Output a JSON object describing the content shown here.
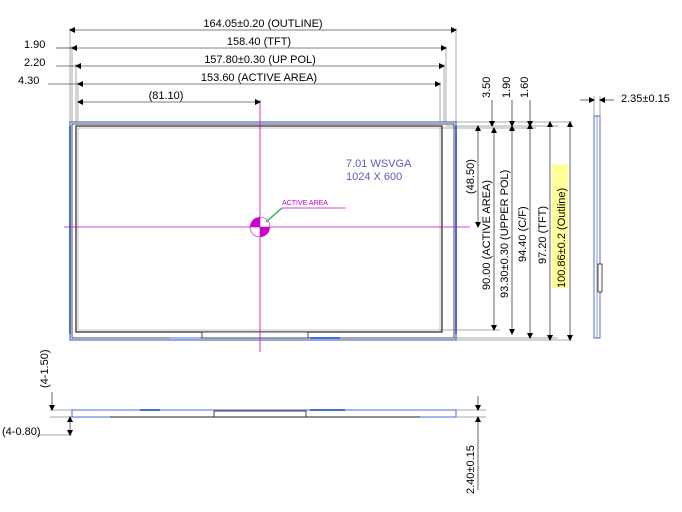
{
  "dimensions": {
    "outline_width": "164.05±0.20 (OUTLINE)",
    "tft_width": "158.40 (TFT)",
    "up_pol_width": "157.80±0.30 (UP POL)",
    "active_area_width": "153.60 (ACTIVE AREA)",
    "center_x": "(81.10)",
    "offset_1": "1.90",
    "offset_2": "2.20",
    "offset_3": "4.30",
    "top_3_50": "3.50",
    "top_1_90": "1.90",
    "top_1_60": "1.60",
    "side_thickness": "2.35±0.15",
    "center_y": "(48.50)",
    "active_area_height": "90.00 (ACTIVE AREA)",
    "upper_pol_height": "93.30±0.30 (UPPER POL)",
    "cf_height": "94.40 (C/F)",
    "tft_height": "97.20 (TFT)",
    "outline_height": "100.86±0.2 (Outline)",
    "side_4_1_50": "(4-1.50)",
    "side_4_0_80": "(4-0.80)",
    "bottom_thickness": "2.40±0.15"
  },
  "panel": {
    "model": "7.01 WSVGA",
    "resolution": "1024 X 600",
    "active_area_label": "ACTIVE AREA"
  },
  "colors": {
    "line": "#000000",
    "frame_blue": "#4a6cd8",
    "centerline": "#cc00cc",
    "arrow_green": "#22aa44",
    "highlight": "#ffff99"
  }
}
